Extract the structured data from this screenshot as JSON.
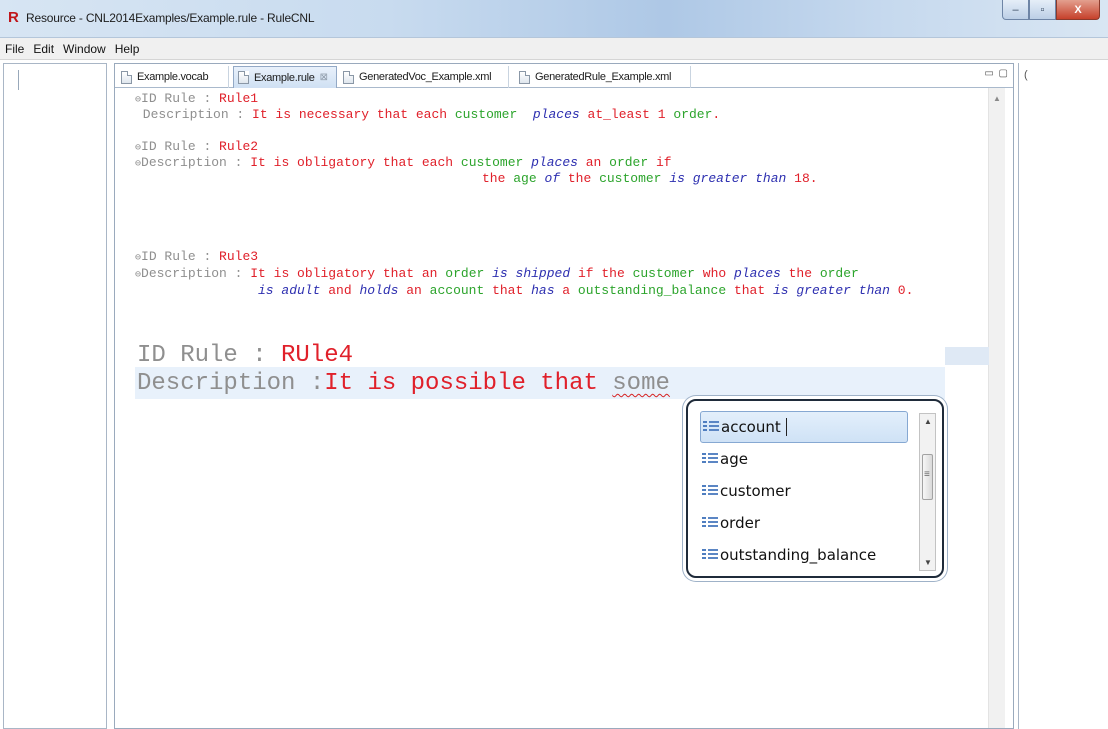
{
  "window": {
    "app_icon": "R",
    "title": "Resource - CNL2014Examples/Example.rule - RuleCNL",
    "controls": {
      "minimize": "–",
      "maximize": "▫",
      "close": "X"
    }
  },
  "menu": {
    "items": [
      "File",
      "Edit",
      "Window",
      "Help"
    ]
  },
  "tabs": [
    {
      "label": "Example.vocab"
    },
    {
      "label": "Example.rule",
      "close": "⊠"
    },
    {
      "label": "GeneratedVoc_Example.xml"
    },
    {
      "label": "GeneratedRule_Example.xml"
    }
  ],
  "editor_controls": "▭ ▢",
  "right_panel_glyph": "(",
  "rules": [
    {
      "id_label": "ID Rule : ",
      "id": "Rule1",
      "desc_label": " Description : ",
      "line1": {
        "a": "It is necessary that each ",
        "b": "customer",
        "c": "places",
        "d": "at_least 1 ",
        "e": "order",
        "f": "."
      }
    },
    {
      "id_label": "ID Rule : ",
      "id": "Rule2",
      "desc_label": "Description : ",
      "line1": {
        "a": "It is obligatory that each ",
        "b": "customer",
        "c": "places",
        "d": " an ",
        "e": "order",
        "f": " if"
      },
      "line2": {
        "a": "the ",
        "b": "age",
        "c": "of",
        "d": "the ",
        "e": "customer",
        "f": "is greater than",
        "g": " 18."
      }
    },
    {
      "id_label": "ID Rule : ",
      "id": "Rule3",
      "desc_label": "Description : ",
      "line1": {
        "a": "It is obligatory that an ",
        "b": "order",
        "c": "is shipped",
        "d": " if the ",
        "e": "customer",
        "f": " who ",
        "g": "places",
        "h": " the ",
        "i": "order"
      },
      "line2": {
        "a": "is adult",
        "b": " and ",
        "c": "holds",
        "d": " an ",
        "e": "account",
        "f": " that ",
        "g": "has",
        "h": " a ",
        "i": "outstanding_balance",
        "j": " that ",
        "k": "is greater than",
        "l": " 0."
      }
    }
  ],
  "current_rule": {
    "id_label": "ID Rule : ",
    "id": "RUle4",
    "desc_label": "Description :",
    "desc_text": "It is possible that ",
    "typed": "some"
  },
  "content_assist": {
    "items": [
      "account",
      "age",
      "customer",
      "order",
      "outstanding_balance"
    ],
    "selected_index": 0
  },
  "colors": {
    "rule_id": "#e0202a",
    "keyword": "#e0202a",
    "noun": "#2ca42c",
    "verb": "#2d2fb0",
    "label": "#8f8f8f"
  }
}
